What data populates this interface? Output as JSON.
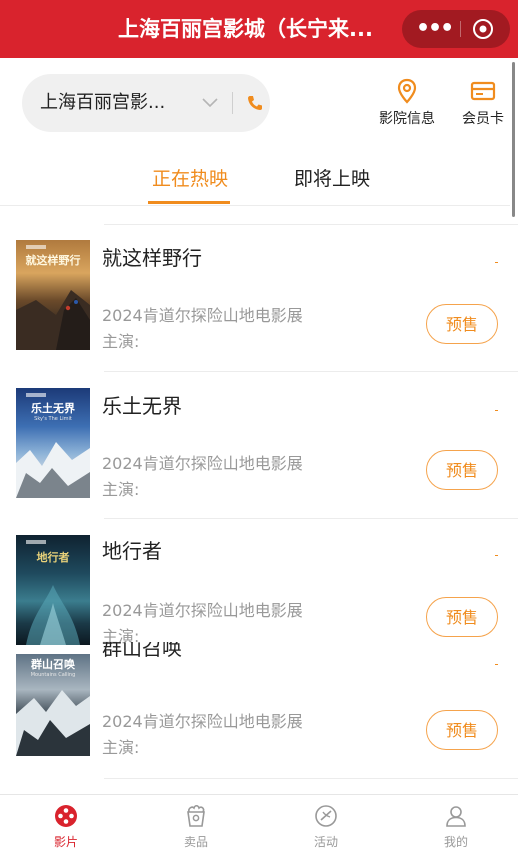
{
  "header": {
    "title": "上海百丽宫影城（长宁来...",
    "more_icon": "more-dots-icon",
    "close_icon": "target-circle-icon"
  },
  "location": {
    "cinema_name": "上海百丽宫影...",
    "chevron_icon": "chevron-down-icon",
    "phone_icon": "phone-icon"
  },
  "quick_links": [
    {
      "label": "影院信息",
      "icon": "location-pin-icon"
    },
    {
      "label": "会员卡",
      "icon": "card-icon"
    }
  ],
  "tabs": {
    "active": "正在热映",
    "inactive": "即将上映"
  },
  "movies": [
    {
      "name": "就这样野行",
      "desc": "2024肯道尔探险山地电影展",
      "cast": "主演:",
      "button": "预售",
      "poster_title": "就这样野行"
    },
    {
      "name": "乐土无界",
      "desc": "2024肯道尔探险山地电影展",
      "cast": "主演:",
      "button": "预售",
      "poster_title": "乐土无界",
      "poster_subtitle": "Sky's The Limit"
    },
    {
      "name": "地行者",
      "desc": "2024肯道尔探险山地电影展",
      "cast": "主演:",
      "button": "预售",
      "poster_title": "地行者"
    },
    {
      "name": "群山召唤",
      "desc": "2024肯道尔探险山地电影展",
      "cast": "主演:",
      "button": "预售",
      "poster_title": "群山召唤",
      "poster_subtitle": "Mountains Calling"
    }
  ],
  "bottom_nav": [
    {
      "label": "影片",
      "icon": "film-reel-icon",
      "active": true
    },
    {
      "label": "卖品",
      "icon": "popcorn-icon",
      "active": false
    },
    {
      "label": "活动",
      "icon": "ticket-icon",
      "active": false
    },
    {
      "label": "我的",
      "icon": "user-icon",
      "active": false
    }
  ],
  "colors": {
    "brand_red": "#d9232d",
    "accent_orange": "#f08c1e"
  }
}
